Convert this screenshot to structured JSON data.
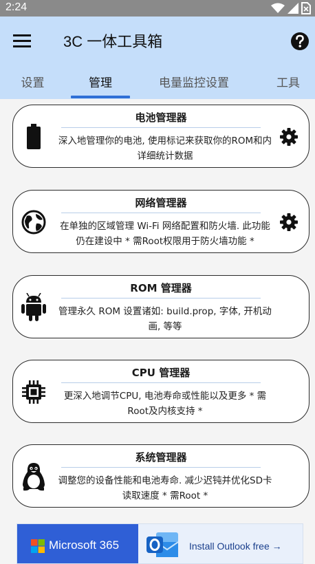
{
  "status_bar": {
    "time": "2:24",
    "icons": [
      "wifi-icon",
      "signal-icon",
      "sim-icon"
    ]
  },
  "app_bar": {
    "title": "3C 一体工具箱",
    "menu_icon": "hamburger-menu-icon",
    "help_icon": "help-icon"
  },
  "tabs": [
    {
      "label": "设置",
      "active": false
    },
    {
      "label": "管理",
      "active": true
    },
    {
      "label": "电量监控设置",
      "active": false
    },
    {
      "label": "工具",
      "active": false
    }
  ],
  "cards": [
    {
      "title": "电池管理器",
      "description": "深入地管理你的电池, 使用标记来获取你的ROM和内详细统计数据",
      "icon": "battery-icon",
      "has_settings": true
    },
    {
      "title": "网络管理器",
      "description": "在单独的区域管理 Wi-Fi 网络配置和防火墙. 此功能仍在建设中 * 需Root权限用于防火墙功能 *",
      "icon": "globe-icon",
      "has_settings": true
    },
    {
      "title": "ROM 管理器",
      "description": "管理永久 ROM 设置诸如: build.prop, 字体, 开机动画, 等等",
      "icon": "android-icon",
      "has_settings": false
    },
    {
      "title": "CPU 管理器",
      "description": "更深入地调节CPU, 电池寿命或性能以及更多 * 需Root及内核支持 *",
      "icon": "cpu-chip-icon",
      "has_settings": false
    },
    {
      "title": "系统管理器",
      "description": "调整您的设备性能和电池寿命. 减少迟钝并优化SD卡读取速度 * 需Root *",
      "icon": "linux-penguin-icon",
      "has_settings": false
    }
  ],
  "ad": {
    "brand": "Microsoft 365",
    "cta": "Install Outlook free →",
    "colors": {
      "left_panel": "#2f5fd6",
      "cta_text": "#1a3f8c"
    }
  },
  "colors": {
    "app_bar": "#c5defa",
    "tab_indicator": "#2f6fd6",
    "card_border": "#2a2a2a"
  }
}
